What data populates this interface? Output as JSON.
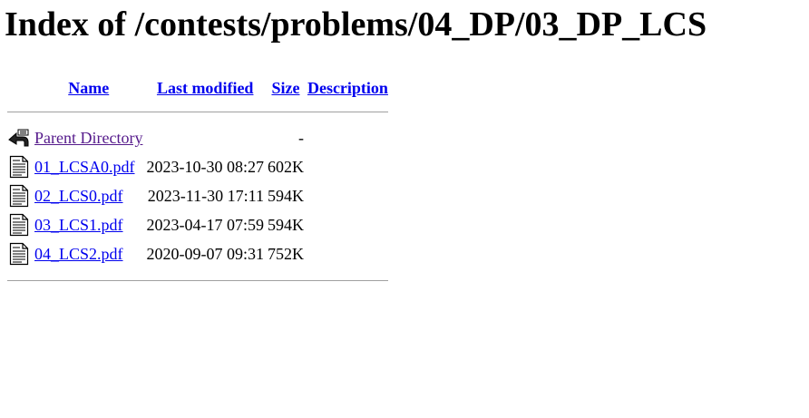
{
  "page": {
    "title": "Index of /contests/problems/04_DP/03_DP_LCS"
  },
  "columns": {
    "name": "Name",
    "last_modified": "Last modified",
    "size": "Size",
    "description": "Description"
  },
  "parent": {
    "label": "Parent Directory",
    "last_modified": "",
    "size": "-"
  },
  "files": [
    {
      "name": "01_LCSA0.pdf",
      "last_modified": "2023-10-30 08:27",
      "size": "602K"
    },
    {
      "name": "02_LCS0.pdf",
      "last_modified": "2023-11-30 17:11",
      "size": "594K"
    },
    {
      "name": "03_LCS1.pdf",
      "last_modified": "2023-04-17 07:59",
      "size": "594K"
    },
    {
      "name": "04_LCS2.pdf",
      "last_modified": "2020-09-07 09:31",
      "size": "752K"
    }
  ],
  "icons": {
    "parent": "back-arrow-icon",
    "file": "text-document-icon"
  },
  "colors": {
    "link": "#0000ee",
    "visited_link": "#551a8b",
    "rule": "#a0a0a0"
  }
}
